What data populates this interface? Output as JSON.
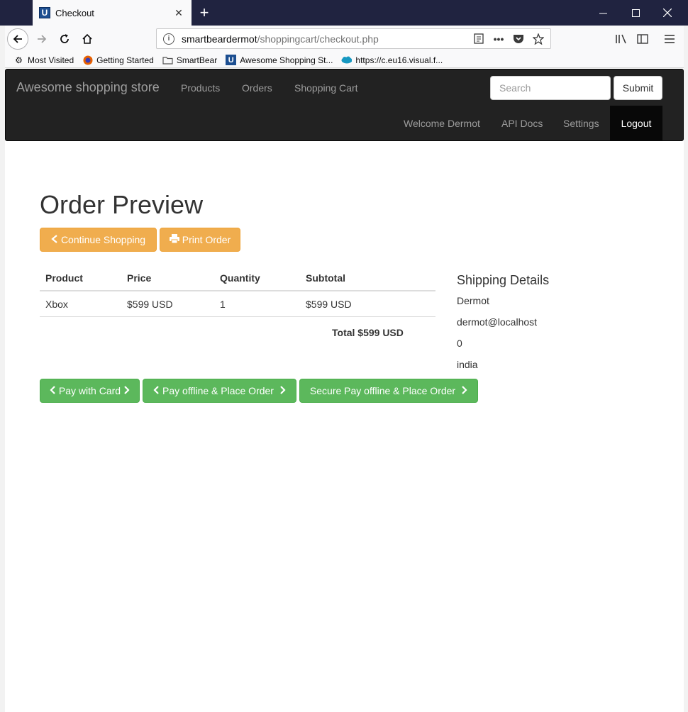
{
  "browser": {
    "tab_title": "Checkout",
    "url_host": "smartbeardermot",
    "url_path": "/shoppingcart/checkout.php",
    "bookmarks": [
      {
        "label": "Most Visited",
        "icon": "gear-icon"
      },
      {
        "label": "Getting Started",
        "icon": "firefox-icon"
      },
      {
        "label": "SmartBear",
        "icon": "folder-icon"
      },
      {
        "label": "Awesome Shopping St...",
        "icon": "u-logo-icon"
      },
      {
        "label": "https://c.eu16.visual.f...",
        "icon": "cloud-icon"
      }
    ]
  },
  "navbar": {
    "brand": "Awesome shopping store",
    "links": [
      "Products",
      "Orders",
      "Shopping Cart"
    ],
    "search_placeholder": "Search",
    "submit_label": "Submit",
    "right_links": [
      "Welcome Dermot",
      "API Docs",
      "Settings"
    ],
    "logout_label": "Logout"
  },
  "page": {
    "title": "Order Preview",
    "continue_label": "Continue Shopping",
    "print_label": "Print Order"
  },
  "cart": {
    "headers": [
      "Product",
      "Price",
      "Quantity",
      "Subtotal"
    ],
    "rows": [
      {
        "product": "Xbox",
        "price": "$599 USD",
        "quantity": "1",
        "subtotal": "$599 USD"
      }
    ],
    "total": "Total $599 USD"
  },
  "shipping": {
    "title": "Shipping Details",
    "name": "Dermot",
    "email": "dermot@localhost",
    "phone": "0",
    "country": "india"
  },
  "payment": {
    "card_label": "Pay with Card",
    "offline_label": "Pay offline & Place Order",
    "secure_label": "Secure Pay offline & Place Order"
  },
  "colors": {
    "navbar_bg": "#222222",
    "warning": "#f0ad4e",
    "success": "#5cb85c"
  }
}
